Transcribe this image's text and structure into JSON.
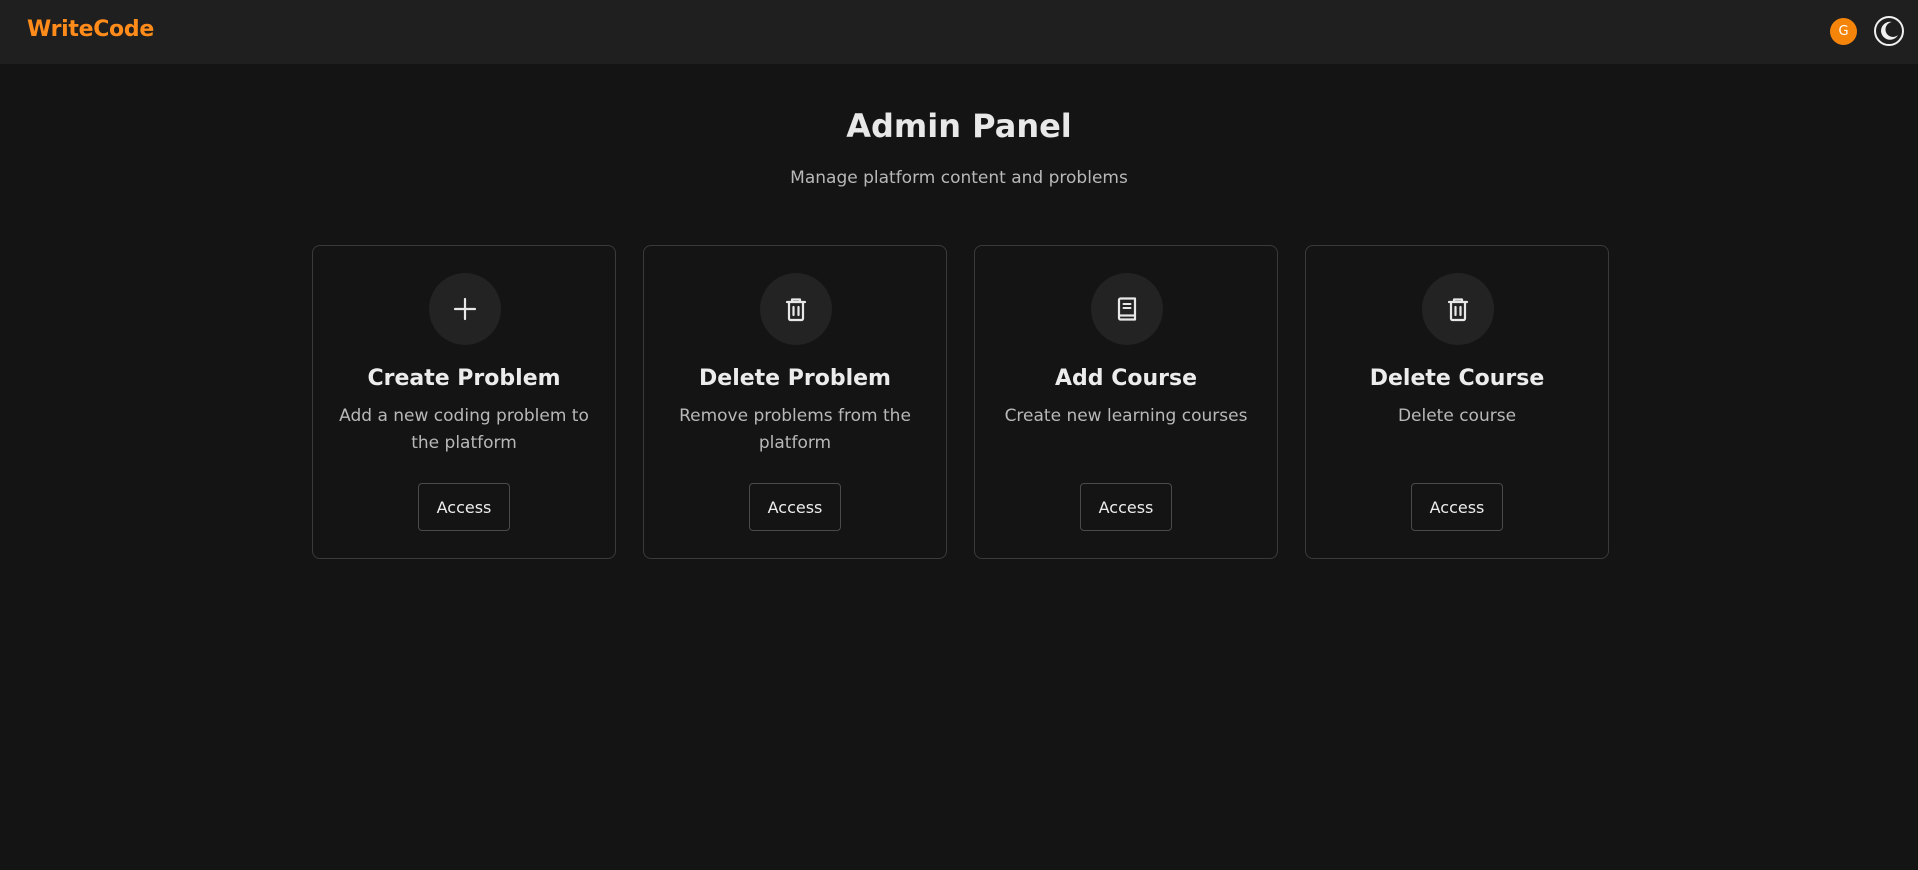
{
  "navbar": {
    "brand": "WriteCode",
    "avatar_initial": "G",
    "theme_icon": "moon-icon",
    "brand_color": "#ff8c1a",
    "avatar_color": "#f5850a"
  },
  "header": {
    "title": "Admin Panel",
    "subtitle": "Manage platform content and problems"
  },
  "cards": [
    {
      "title": "Create Problem",
      "description": "Add a new coding problem to the platform",
      "icon": "plus-icon",
      "button_label": "Access"
    },
    {
      "title": "Delete Problem",
      "description": "Remove problems from the platform",
      "icon": "trash-icon",
      "button_label": "Access"
    },
    {
      "title": "Add Course",
      "description": "Create new learning courses",
      "icon": "book-icon",
      "button_label": "Access"
    },
    {
      "title": "Delete Course",
      "description": "Delete course",
      "icon": "trash-icon",
      "button_label": "Access"
    }
  ]
}
